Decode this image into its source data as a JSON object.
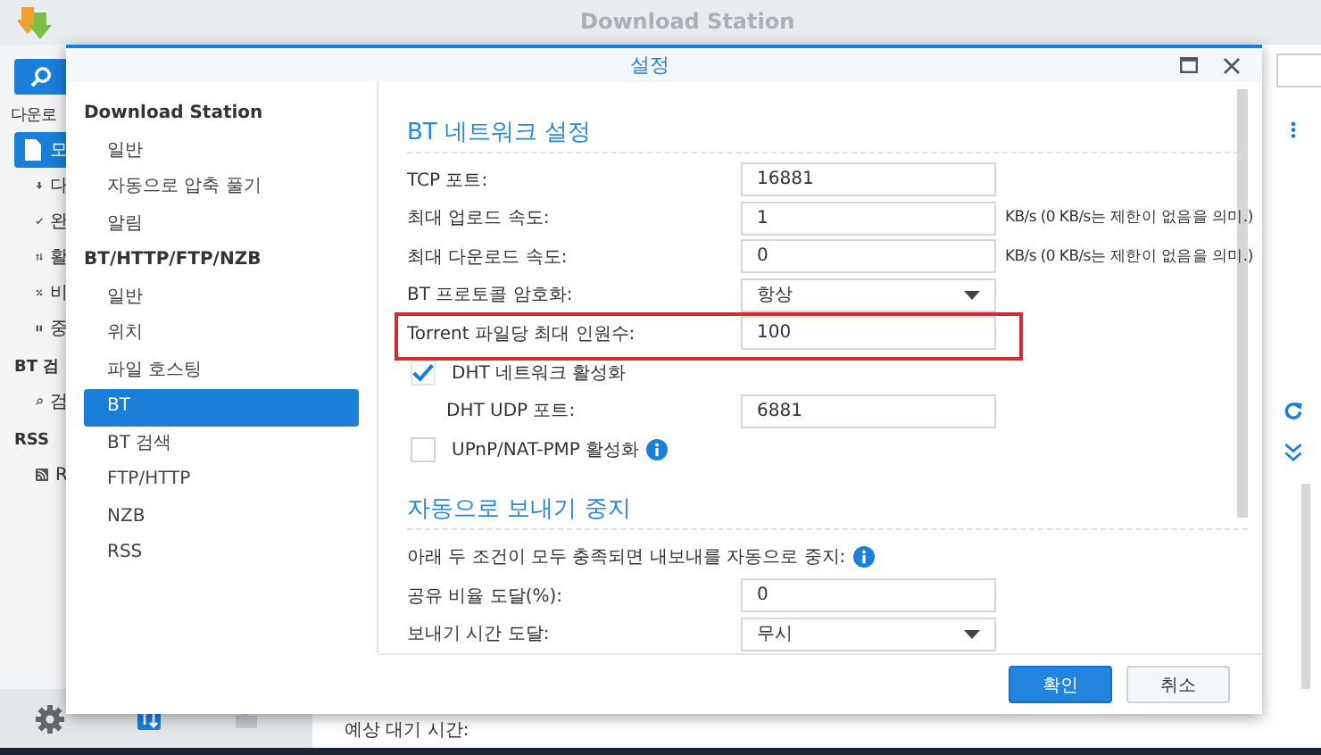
{
  "app": {
    "title": "Download Station",
    "sidebar": [
      {
        "heading": "다운로",
        "items": [
          {
            "label": "모",
            "selected": true
          },
          {
            "label": "다",
            "selected": false
          },
          {
            "label": "완",
            "selected": false
          },
          {
            "label": "활",
            "selected": false
          },
          {
            "label": "비",
            "selected": false
          },
          {
            "label": "중",
            "selected": false
          }
        ]
      },
      {
        "heading": "BT 검",
        "items": [
          {
            "label": "검",
            "selected": false
          }
        ]
      },
      {
        "heading": "RSS",
        "items": [
          {
            "label": "R",
            "selected": false
          }
        ]
      }
    ],
    "status_label": "예상 대기 시간:"
  },
  "dialog": {
    "title": "설정",
    "nav": [
      {
        "heading": "Download Station",
        "items": [
          {
            "label": "일반",
            "selected": false
          },
          {
            "label": "자동으로 압축 풀기",
            "selected": false
          },
          {
            "label": "알림",
            "selected": false
          }
        ]
      },
      {
        "heading": "BT/HTTP/FTP/NZB",
        "items": [
          {
            "label": "일반",
            "selected": false
          },
          {
            "label": "위치",
            "selected": false
          },
          {
            "label": "파일 호스팅",
            "selected": false
          },
          {
            "label": "BT",
            "selected": true
          },
          {
            "label": "BT 검색",
            "selected": false
          },
          {
            "label": "FTP/HTTP",
            "selected": false
          },
          {
            "label": "NZB",
            "selected": false
          },
          {
            "label": "RSS",
            "selected": false
          }
        ]
      }
    ],
    "sections": [
      {
        "title": "BT 네트워크 설정",
        "rows": [
          {
            "kind": "input",
            "label": "TCP 포트:",
            "value": "16881"
          },
          {
            "kind": "input",
            "label": "최대 업로드 속도:",
            "value": "1",
            "unit": "KB/s (0 KB/s는 제한이 없음을 의미.)"
          },
          {
            "kind": "input",
            "label": "최대 다운로드 속도:",
            "value": "0",
            "unit": "KB/s (0 KB/s는 제한이 없음을 의미.)"
          },
          {
            "kind": "select",
            "label": "BT 프로토콜 암호화:",
            "value": "항상"
          },
          {
            "kind": "input",
            "label": "Torrent 파일당 최대 인원수:",
            "value": "100",
            "highlighted": true
          },
          {
            "kind": "checkbox",
            "label": "DHT 네트워크 활성화",
            "checked": true
          },
          {
            "kind": "input",
            "label": "DHT UDP 포트:",
            "value": "6881",
            "indented": true
          },
          {
            "kind": "checkbox",
            "label": "UPnP/NAT-PMP 활성화",
            "checked": false,
            "info": true
          }
        ]
      },
      {
        "title": "자동으로 보내기 중지",
        "rows": [
          {
            "kind": "note",
            "label": "아래 두 조건이 모두 충족되면 내보내를 자동으로 중지:",
            "info": true
          },
          {
            "kind": "input",
            "label": "공유 비율 도달(%):",
            "value": "0"
          },
          {
            "kind": "select",
            "label": "보내기 시간 도달:",
            "value": "무시"
          }
        ]
      }
    ],
    "buttons": [
      {
        "label": "확인",
        "primary": true
      },
      {
        "label": "취소",
        "primary": false
      }
    ]
  }
}
